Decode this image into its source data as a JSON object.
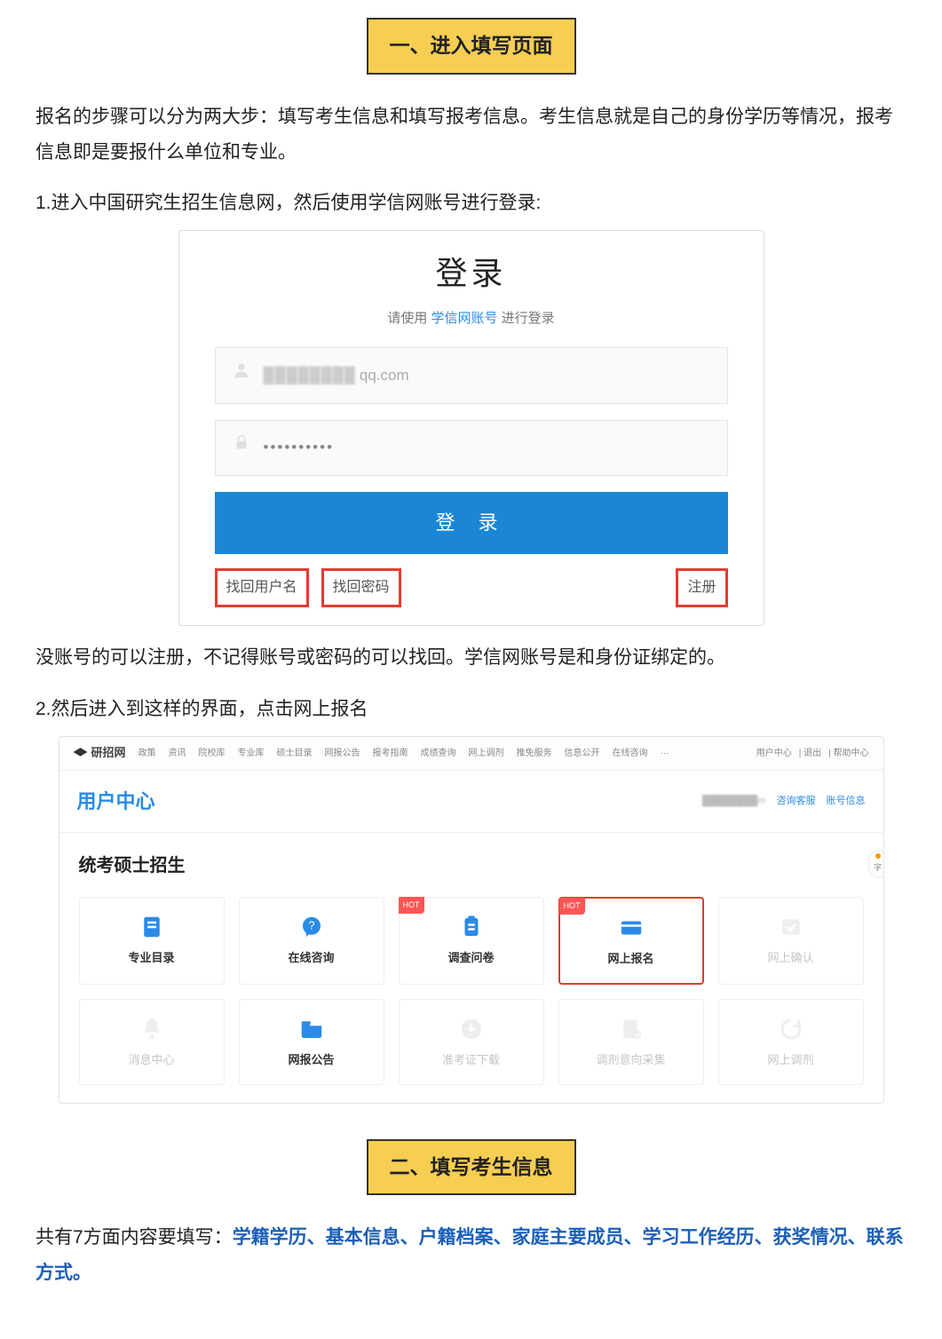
{
  "section1": {
    "heading": "一、进入填写页面",
    "para_intro": "报名的步骤可以分为两大步：填写考生信息和填写报考信息。考生信息就是自己的身份学历等情况，报考信息即是要报什么单位和专业。",
    "step1": "1.进入中国研究生招生信息网，然后使用学信网账号进行登录:",
    "login": {
      "title": "登录",
      "sub_prefix": "请使用 ",
      "sub_link": "学信网账号",
      "sub_suffix": " 进行登录",
      "user_suffix": "qq.com",
      "pass_dots": "••••••••••",
      "button": "登 录",
      "find_user": "找回用户名",
      "find_pass": "找回密码",
      "register": "注册"
    },
    "para_after_login": "没账号的可以注册，不记得账号或密码的可以找回。学信网账号是和身份证绑定的。",
    "step2": "2.然后进入到这样的界面，点击网上报名",
    "dash": {
      "logo": "研招网",
      "nav": [
        "政策",
        "资讯",
        "院校库",
        "专业库",
        "硕士目录",
        "网报公告",
        "报考指南",
        "成绩查询",
        "网上调剂",
        "推免服务",
        "信息公开",
        "在线咨询",
        "···"
      ],
      "top_right": [
        "用户中心",
        "退出",
        "帮助中心"
      ],
      "usercenter": "用户中心",
      "user_right_masked": "m",
      "user_right_links": [
        "咨询客服",
        "账号信息"
      ],
      "section_title": "统考硕士招生",
      "cards": [
        {
          "label": "专业目录",
          "icon": "doc",
          "state": "on"
        },
        {
          "label": "在线咨询",
          "icon": "chat",
          "state": "on"
        },
        {
          "label": "调查问卷",
          "icon": "clip",
          "state": "on",
          "hot": "HOT"
        },
        {
          "label": "网上报名",
          "icon": "card",
          "state": "on",
          "hot": "HOT",
          "highlight": true
        },
        {
          "label": "网上确认",
          "icon": "check",
          "state": "off"
        },
        {
          "label": "消息中心",
          "icon": "bell",
          "state": "off"
        },
        {
          "label": "网报公告",
          "icon": "folder",
          "state": "on"
        },
        {
          "label": "准考证下载",
          "icon": "download",
          "state": "off"
        },
        {
          "label": "调剂意向采集",
          "icon": "collect",
          "state": "off"
        },
        {
          "label": "网上调剂",
          "icon": "refresh",
          "state": "off"
        }
      ]
    }
  },
  "section2": {
    "heading": "二、填写考生信息",
    "para_prefix": "共有7方面内容要填写：",
    "para_bold": "学籍学历、基本信息、户籍档案、家庭主要成员、学习工作经历、获奖情况、联系方式。"
  }
}
